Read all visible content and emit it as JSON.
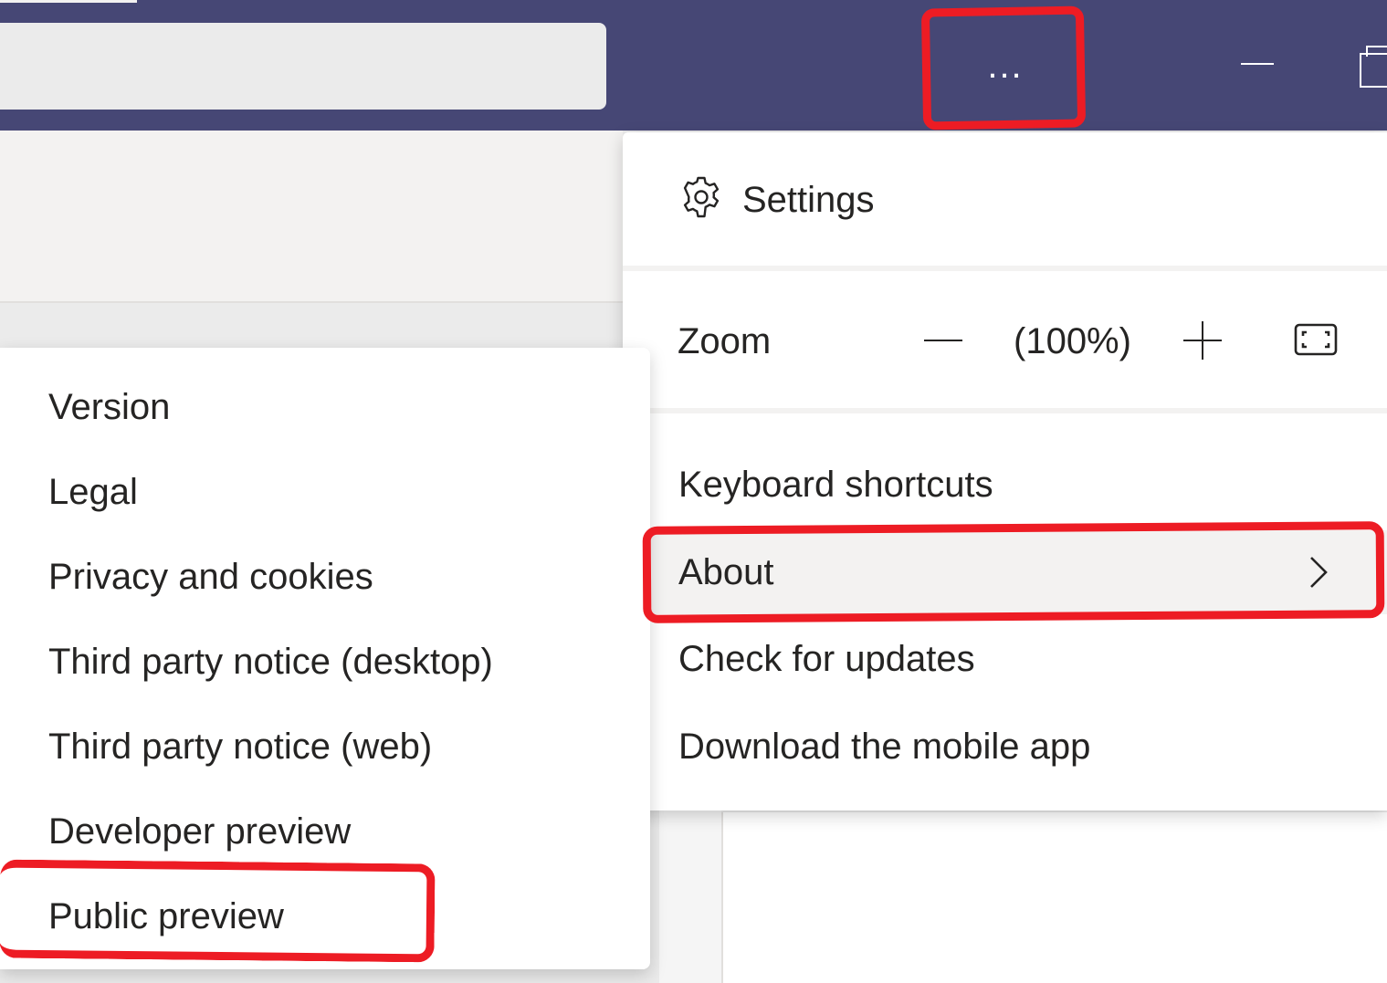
{
  "titlebar": {
    "more_label": "...",
    "background_color": "#464775"
  },
  "main_menu": {
    "settings_label": "Settings",
    "zoom": {
      "label": "Zoom",
      "value": "(100%)"
    },
    "items": [
      {
        "label": "Keyboard shortcuts"
      },
      {
        "label": "About"
      },
      {
        "label": "Check for updates"
      },
      {
        "label": "Download the mobile app"
      }
    ]
  },
  "about_submenu": {
    "items": [
      {
        "label": "Version"
      },
      {
        "label": "Legal"
      },
      {
        "label": "Privacy and cookies"
      },
      {
        "label": "Third party notice (desktop)"
      },
      {
        "label": "Third party notice (web)"
      },
      {
        "label": "Developer preview"
      },
      {
        "label": "Public preview"
      }
    ]
  },
  "annotation_color": "#ed1c24"
}
